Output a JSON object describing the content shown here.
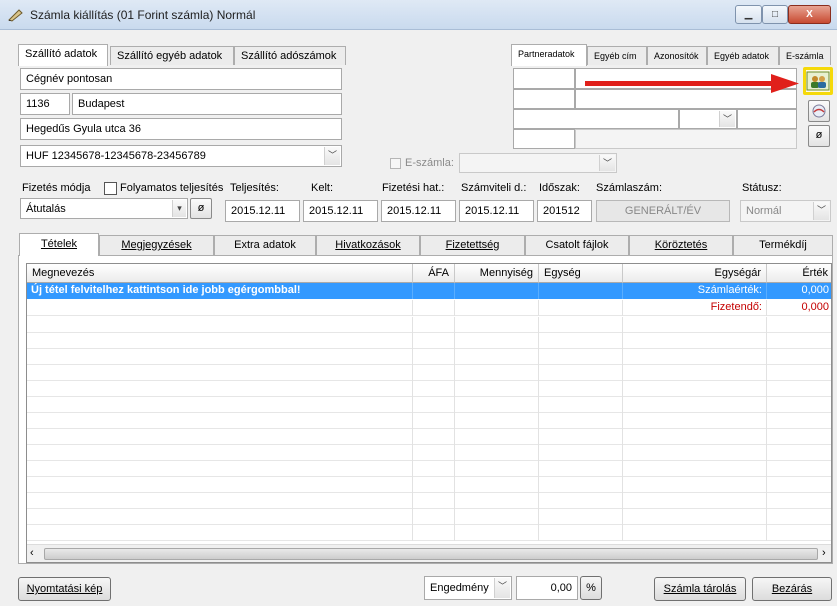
{
  "window": {
    "title": "Számla kiállítás (01 Forint számla) Normál",
    "close_glyph": "X",
    "min_glyph": "▁",
    "max_glyph": "□"
  },
  "supplier_tabs": [
    "Szállító adatok",
    "Szállító egyéb adatok",
    "Szállító adószámok"
  ],
  "supplier": {
    "company": "Cégnév pontosan",
    "zip": "1136",
    "city": "Budapest",
    "street": "Hegedűs Gyula utca 36",
    "account": "HUF 12345678-12345678-23456789"
  },
  "partner_tabs": [
    "Partneradatok",
    "Egyéb cím",
    "Azonosítók",
    "Egyéb adatok",
    "E-számla"
  ],
  "partner_buttons": {
    "lookup_icon": "people-icon",
    "clear_glyph": "ø"
  },
  "e_invoice": {
    "label": "E-számla:"
  },
  "header_fields": {
    "payment_label": "Fizetés módja",
    "continuous_label": "Folyamatos teljesítés",
    "fulfillment_label": "Teljesítés:",
    "issued_label": "Kelt:",
    "due_label": "Fizetési hat.:",
    "accounting_label": "Számviteli d.:",
    "period_label": "Időszak:",
    "number_label": "Számlaszám:",
    "status_label": "Státusz:",
    "payment_value": "Átutalás",
    "fulfillment_value": "2015.12.11",
    "issued_value": "2015.12.11",
    "due_value": "2015.12.11",
    "accounting_value": "2015.12.11",
    "period_value": "201512",
    "number_value": "GENERÁLT/ÉV",
    "status_value": "Normál",
    "clear_glyph": "ø"
  },
  "main_tabs": [
    "Tételek",
    "Megjegyzések",
    "Extra adatok",
    "Hivatkozások",
    "Fizetettség",
    "Csatolt fájlok",
    "Köröztetés",
    "Termékdíj"
  ],
  "grid": {
    "headers": [
      "Megnevezés",
      "ÁFA",
      "Mennyiség",
      "Egység",
      "Egységár",
      "Érték"
    ],
    "new_row_hint": "Új tétel felvitelhez kattintson ide jobb egérgombbal!",
    "invoice_value_label": "Számlaérték:",
    "invoice_value": "0,000",
    "payable_label": "Fizetendő:",
    "payable_value": "0,000"
  },
  "footer": {
    "print_preview": "Nyomtatási kép",
    "discount_label": "Engedmény",
    "discount_value": "0,00",
    "percent": "%",
    "save": "Számla tárolás",
    "close": "Bezárás"
  },
  "colors": {
    "selection": "#3399ff",
    "arrow": "#e0201b",
    "highlight": "#f5d90a"
  }
}
